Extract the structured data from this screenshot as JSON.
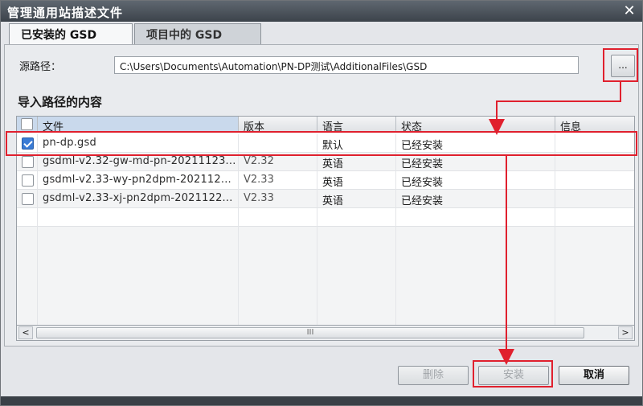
{
  "window": {
    "title": "管理通用站描述文件",
    "close_glyph": "✕"
  },
  "tabs": [
    {
      "label": "已安装的 GSD",
      "active": true
    },
    {
      "label": "项目中的 GSD",
      "active": false
    }
  ],
  "source": {
    "label": "源路径：",
    "path": "C:\\Users\\Documents\\Automation\\PN-DP测试\\AdditionalFiles\\GSD",
    "browse_label": "..."
  },
  "content_section": {
    "title": "导入路径的内容"
  },
  "table": {
    "columns": [
      "文件",
      "版本",
      "语言",
      "状态",
      "信息"
    ],
    "rows": [
      {
        "checked": true,
        "file": "pn-dp.gsd",
        "version": "",
        "language": "默认",
        "status": "已经安装",
        "info": ""
      },
      {
        "checked": false,
        "file": "gsdml-v2.32-gw-md-pn-20211123...",
        "version": "V2.32",
        "language": "英语",
        "status": "已经安装",
        "info": ""
      },
      {
        "checked": false,
        "file": "gsdml-v2.33-wy-pn2dpm-202112...",
        "version": "V2.33",
        "language": "英语",
        "status": "已经安装",
        "info": ""
      },
      {
        "checked": false,
        "file": "gsdml-v2.33-xj-pn2dpm-2021122...",
        "version": "V2.33",
        "language": "英语",
        "status": "已经安装",
        "info": ""
      }
    ]
  },
  "scrollbar": {
    "left_arrow": "<",
    "right_arrow": ">",
    "thumb_grip": "III"
  },
  "buttons": {
    "delete": "删除",
    "install": "安装",
    "cancel": "取消"
  },
  "colors": {
    "highlight": "#e0202e",
    "check_accent": "#3a7bd5",
    "titlebar": "#4a525a"
  }
}
